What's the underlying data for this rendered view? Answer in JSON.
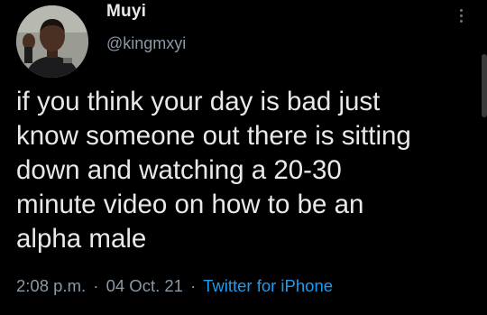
{
  "author": {
    "display_name": "Muyi",
    "handle": "@kingmxyi",
    "avatar_icon": "profile-photo"
  },
  "tweet": {
    "text": "if you think your day is bad just\nknow someone out there is sitting\ndown and watching a 20-30\nminute video on how to be an\nalpha male"
  },
  "meta": {
    "time": "2:08 p.m.",
    "separator": "·",
    "date": "04 Oct. 21",
    "source": "Twitter for iPhone"
  },
  "colors": {
    "background": "#000000",
    "text": "#e7e9ea",
    "secondary": "#8b98a5",
    "link": "#1d9bf0"
  },
  "icons": {
    "more": "more-vertical-icon"
  }
}
